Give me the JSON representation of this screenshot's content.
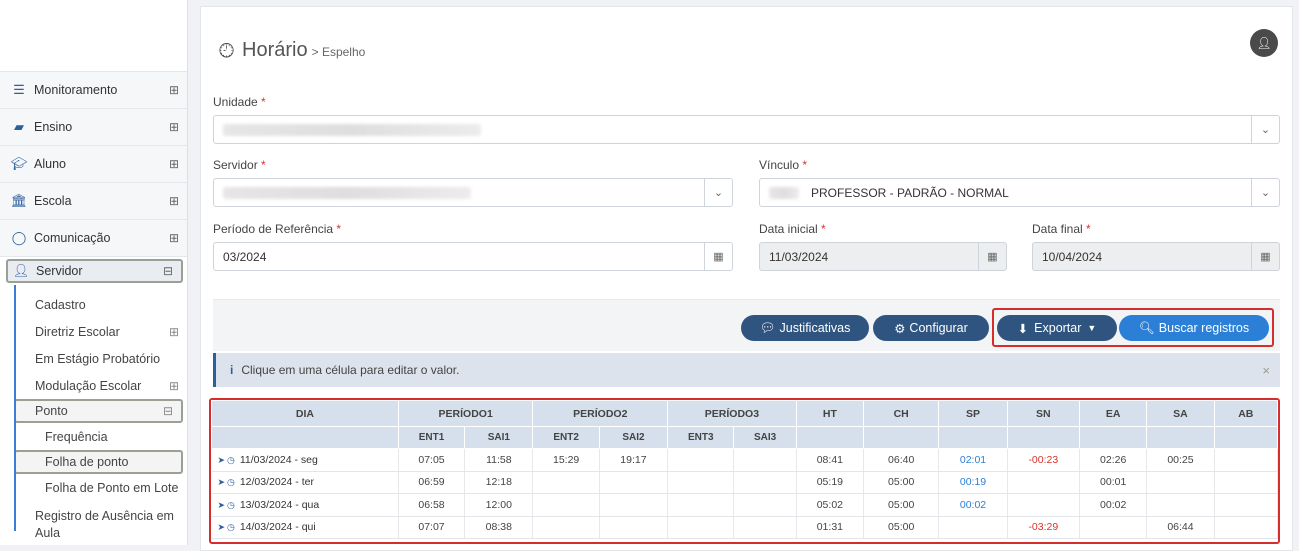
{
  "sidebar": {
    "items": [
      {
        "label": "Monitoramento",
        "icon": "sliders-icon",
        "toggle": "⊞"
      },
      {
        "label": "Ensino",
        "icon": "book-icon",
        "toggle": "⊞"
      },
      {
        "label": "Aluno",
        "icon": "graduation-cap-icon",
        "toggle": "⊞"
      },
      {
        "label": "Escola",
        "icon": "institution-icon",
        "toggle": "⊞"
      },
      {
        "label": "Comunicação",
        "icon": "chat-bubble-icon",
        "toggle": "⊞"
      },
      {
        "label": "Servidor",
        "icon": "user-icon",
        "toggle": "⊟"
      }
    ],
    "sub": [
      {
        "label": "Cadastro",
        "toggle": ""
      },
      {
        "label": "Diretriz Escolar",
        "toggle": "⊞"
      },
      {
        "label": "Em Estágio Probatório",
        "toggle": ""
      },
      {
        "label": "Modulação Escolar",
        "toggle": "⊞"
      },
      {
        "label": "Ponto",
        "toggle": "⊟"
      }
    ],
    "subsub": [
      {
        "label": "Frequência"
      },
      {
        "label": "Folha de ponto"
      },
      {
        "label": "Folha de Ponto em Lote"
      }
    ],
    "last": "Registro de Ausência em Aula"
  },
  "header": {
    "title": "Horário",
    "crumb": "> Espelho"
  },
  "form": {
    "unidade_label": "Unidade",
    "servidor_label": "Servidor",
    "vinculo_label": "Vínculo",
    "vinculo_value": "PROFESSOR - PADRÃO - NORMAL",
    "periodo_label": "Período de Referência",
    "periodo_value": "03/2024",
    "data_inicial_label": "Data inicial",
    "data_inicial_value": "11/03/2024",
    "data_final_label": "Data final",
    "data_final_value": "10/04/2024",
    "required_mark": "*"
  },
  "actions": {
    "justificativas": "Justificativas",
    "configurar": "Configurar",
    "exportar": "Exportar",
    "buscar": "Buscar registros"
  },
  "info": {
    "text": "Clique em uma célula para editar o valor.",
    "icon": "i"
  },
  "table": {
    "header": [
      "DIA",
      "PERÍODO1",
      "PERÍODO2",
      "PERÍODO3",
      "HT",
      "CH",
      "SP",
      "SN",
      "EA",
      "SA",
      "AB"
    ],
    "subheader": [
      "ENT1",
      "SAI1",
      "ENT2",
      "SAI2",
      "ENT3",
      "SAI3"
    ],
    "rows": [
      {
        "dia": "11/03/2024 - seg",
        "ent1": "07:05",
        "sai1": "11:58",
        "ent2": "15:29",
        "sai2": "19:17",
        "ent3": "",
        "sai3": "",
        "ht": "08:41",
        "ch": "06:40",
        "sp": "02:01",
        "sn": "-00:23",
        "ea": "02:26",
        "sa": "00:25",
        "ab": ""
      },
      {
        "dia": "12/03/2024 - ter",
        "ent1": "06:59",
        "sai1": "12:18",
        "ent2": "",
        "sai2": "",
        "ent3": "",
        "sai3": "",
        "ht": "05:19",
        "ch": "05:00",
        "sp": "00:19",
        "sn": "",
        "ea": "00:01",
        "sa": "",
        "ab": ""
      },
      {
        "dia": "13/03/2024 - qua",
        "ent1": "06:58",
        "sai1": "12:00",
        "ent2": "",
        "sai2": "",
        "ent3": "",
        "sai3": "",
        "ht": "05:02",
        "ch": "05:00",
        "sp": "00:02",
        "sn": "",
        "ea": "00:02",
        "sa": "",
        "ab": ""
      },
      {
        "dia": "14/03/2024 - qui",
        "ent1": "07:07",
        "sai1": "08:38",
        "ent2": "",
        "sai2": "",
        "ent3": "",
        "sai3": "",
        "ht": "01:31",
        "ch": "05:00",
        "sp": "",
        "sn": "-03:29",
        "ea": "",
        "sa": "06:44",
        "ab": ""
      }
    ]
  },
  "colors": {
    "primary_dark": "#2f5480",
    "primary_blue": "#2c7fd6",
    "highlight_red": "#d62d2d",
    "negative": "#d9342b"
  }
}
